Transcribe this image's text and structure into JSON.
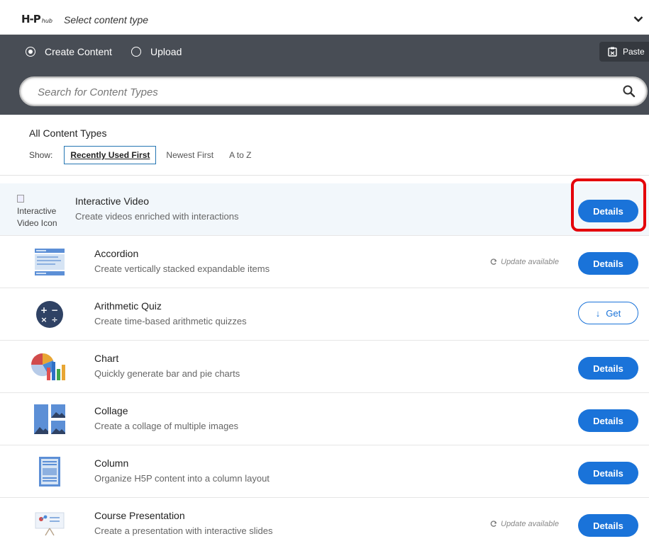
{
  "topbar": {
    "logo_main": "H-P",
    "logo_sub": "hub",
    "title": "Select content type"
  },
  "tabs": [
    {
      "label": "Create Content",
      "selected": true
    },
    {
      "label": "Upload",
      "selected": false
    }
  ],
  "paste_label": "Paste",
  "search": {
    "placeholder": "Search for Content Types"
  },
  "filters": {
    "heading": "All Content Types",
    "show_label": "Show:",
    "options": [
      "Recently Used First",
      "Newest First",
      "A to Z"
    ],
    "active_index": 0
  },
  "items": [
    {
      "title": "Interactive Video",
      "desc": "Create videos enriched with interactions",
      "icon_alt": "Interactive Video Icon",
      "action": "Details",
      "update": ""
    },
    {
      "title": "Accordion",
      "desc": "Create vertically stacked expandable items",
      "icon": "accordion-icon",
      "action": "Details",
      "update": "Update available"
    },
    {
      "title": "Arithmetic Quiz",
      "desc": "Create time-based arithmetic quizzes",
      "icon": "arithmetic-quiz-icon",
      "action": "Get",
      "update": ""
    },
    {
      "title": "Chart",
      "desc": "Quickly generate bar and pie charts",
      "icon": "chart-icon",
      "action": "Details",
      "update": ""
    },
    {
      "title": "Collage",
      "desc": "Create a collage of multiple images",
      "icon": "collage-icon",
      "action": "Details",
      "update": ""
    },
    {
      "title": "Column",
      "desc": "Organize H5P content into a column layout",
      "icon": "column-icon",
      "action": "Details",
      "update": ""
    },
    {
      "title": "Course Presentation",
      "desc": "Create a presentation with interactive slides",
      "icon": "course-presentation-icon",
      "action": "Details",
      "update": "Update available"
    }
  ],
  "colors": {
    "header_dark": "#484d55",
    "accent_blue": "#1a73d9",
    "highlight_red": "#e4000a"
  }
}
